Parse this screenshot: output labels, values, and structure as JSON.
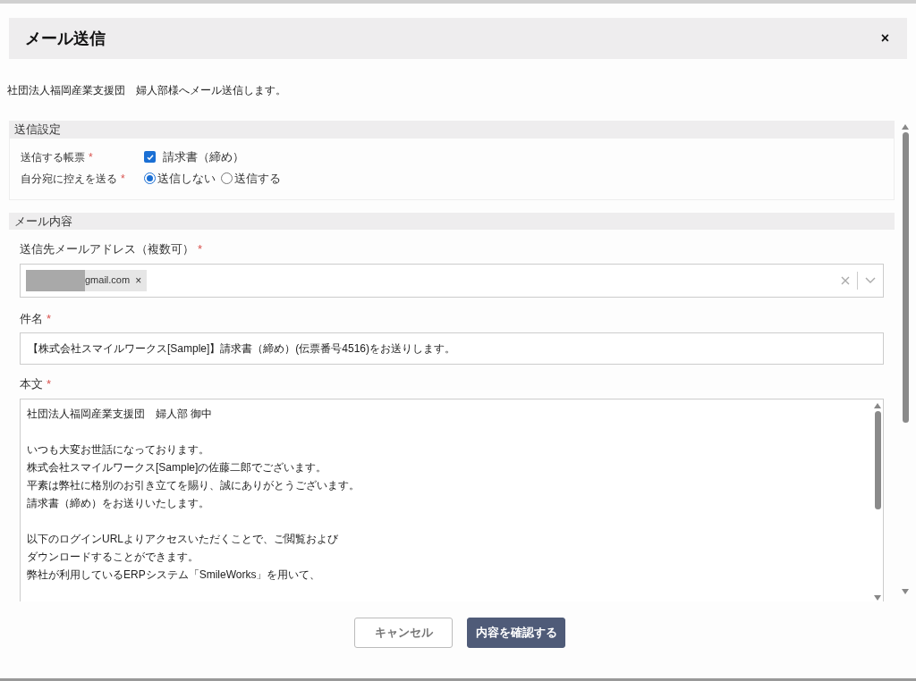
{
  "dialog": {
    "title": "メール送信",
    "close": "×"
  },
  "intro": "社団法人福岡産業支援団　婦人部様へメール送信します。",
  "send_settings": {
    "title": "送信設定",
    "rows": [
      {
        "kind": "checkbox",
        "label": "送信する帳票",
        "required": "*",
        "options": [
          {
            "label": "請求書（締め）",
            "checked": true
          }
        ]
      },
      {
        "kind": "radio",
        "label": "自分宛に控えを送る",
        "required": "*",
        "options": [
          {
            "label": "送信しない",
            "selected": true
          },
          {
            "label": "送信する",
            "selected": false
          }
        ]
      }
    ]
  },
  "mail": {
    "title": "メール内容",
    "recipients": {
      "label": "送信先メールアドレス（複数可）",
      "required": "*",
      "chips": [
        {
          "text": "gmail.com",
          "remove": "×",
          "redacted": true
        }
      ]
    },
    "subject": {
      "label": "件名",
      "required": "*",
      "value": "【株式会社スマイルワークス[Sample]】請求書（締め）(伝票番号4516)をお送りします。"
    },
    "body": {
      "label": "本文",
      "required": "*",
      "paragraphs": [
        [
          "社団法人福岡産業支援団　婦人部 御中"
        ],
        [
          "いつも大変お世話になっております。",
          "株式会社スマイルワークス[Sample]の佐藤二郎でございます。",
          "平素は弊社に格別のお引き立てを賜り、誠にありがとうございます。",
          "請求書（締め）をお送りいたします。"
        ],
        [
          "以下のログインURLよりアクセスいただくことで、ご閲覧および",
          "ダウンロードすることができます。",
          "弊社が利用しているERPシステム「SmileWorks」を用いて、"
        ]
      ]
    }
  },
  "buttons": [
    {
      "kind": "secondary",
      "label": "キャンセル"
    },
    {
      "kind": "primary",
      "label": "内容を確認する"
    }
  ]
}
